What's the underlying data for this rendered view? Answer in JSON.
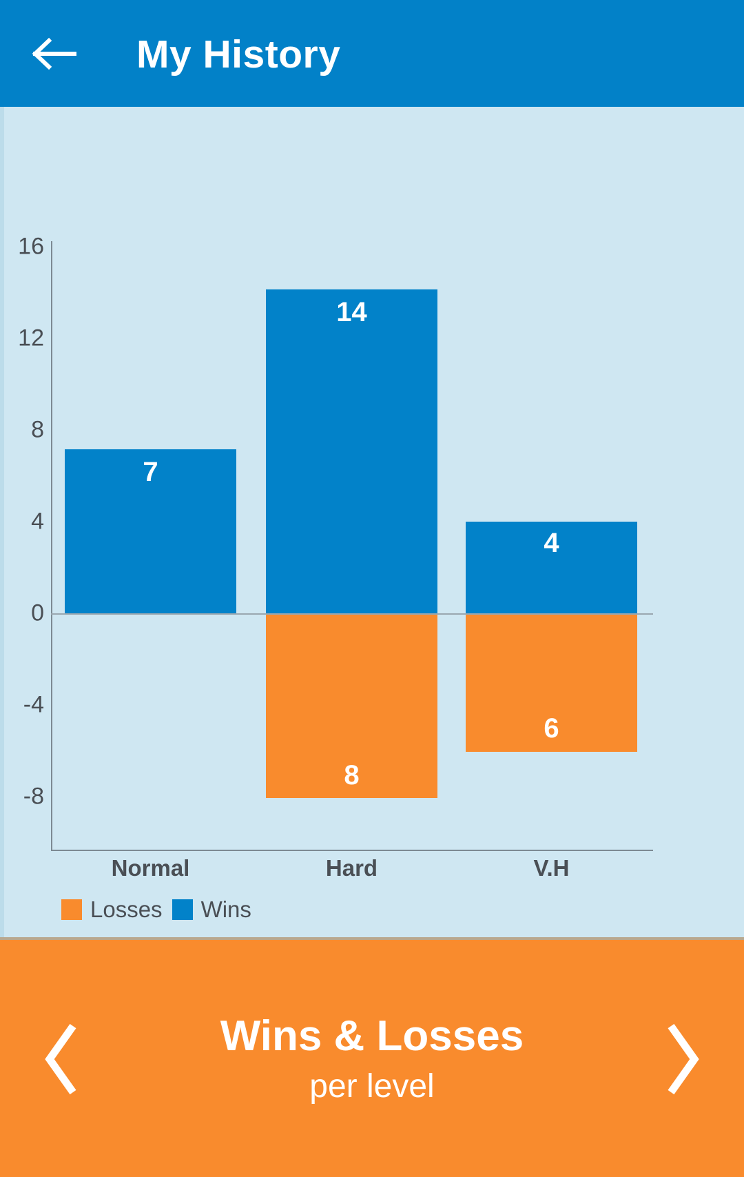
{
  "header": {
    "title": "My History",
    "back_icon": "arrow-left-icon",
    "bg_color": "#0281c8"
  },
  "chart_data": {
    "type": "bar",
    "title": "Wins & Losses",
    "subtitle": "per level",
    "xlabel": "",
    "ylabel": "",
    "categories": [
      "Normal",
      "Hard",
      "V.H"
    ],
    "series": [
      {
        "name": "Wins",
        "color": "#0282c9",
        "values": [
          7,
          14,
          4
        ]
      },
      {
        "name": "Losses",
        "color": "#f98b2d",
        "values": [
          0,
          8,
          6
        ]
      }
    ],
    "bar_labels": {
      "wins": [
        "7",
        "14",
        "4"
      ],
      "losses": [
        "",
        "8",
        "6"
      ]
    },
    "ylim": [
      -9.5,
      17.2
    ],
    "yticks": [
      16,
      12,
      8,
      4,
      0,
      -4,
      -8
    ],
    "ytick_labels": [
      "16",
      "12",
      "8",
      "4",
      "0",
      "-4",
      "-8"
    ],
    "grid": false,
    "legend_position": "bottom-left",
    "note": "Losses are plotted as negative values below the zero line."
  },
  "legend": {
    "items": [
      {
        "label": "Losses",
        "color": "#f98b2d"
      },
      {
        "label": "Wins",
        "color": "#0282c9"
      }
    ]
  },
  "toolbar": {
    "buttons": [
      {
        "name": "chart-type-button",
        "icon": "line-chart-icon",
        "enabled": true,
        "bg": "#d8d4cb"
      },
      {
        "name": "help-button",
        "icon": "question-mark-icon",
        "enabled": true,
        "bg": "#0b7fc4"
      },
      {
        "name": "zoom-in-button",
        "icon": "magnifier-plus-icon",
        "enabled": false,
        "bg": "#a8d5ec"
      },
      {
        "name": "zoom-out-button",
        "icon": "magnifier-minus-icon",
        "enabled": false,
        "bg": "#a8d5ec"
      }
    ]
  },
  "bottom_bar": {
    "title": "Wins & Losses",
    "subtitle": "per level",
    "prev_icon": "chevron-left-icon",
    "next_icon": "chevron-right-icon",
    "bg_color": "#f98b2d"
  }
}
